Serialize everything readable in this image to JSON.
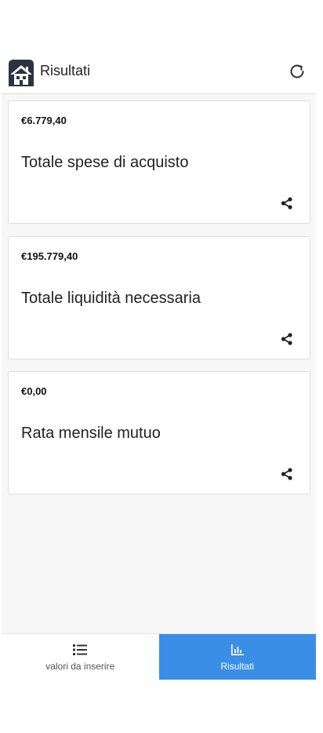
{
  "header": {
    "title": "Risultati",
    "logo_icon": "house-icon",
    "refresh_icon": "refresh-icon"
  },
  "cards": [
    {
      "amount": "€6.779,40",
      "label": "Totale spese di acquisto",
      "action_icon": "share-icon"
    },
    {
      "amount": "€195.779,40",
      "label": "Totale liquidità necessaria",
      "action_icon": "share-icon"
    },
    {
      "amount": "€0,00",
      "label": "Rata mensile mutuo",
      "action_icon": "share-icon"
    }
  ],
  "tabs": [
    {
      "label": "valori da inserire",
      "icon": "list-icon",
      "active": false
    },
    {
      "label": "Risultati",
      "icon": "bar-chart-icon",
      "active": true
    }
  ],
  "colors": {
    "accent": "#3a8ee6",
    "logo_dark": "#2b3340",
    "background": "#f7f7f7"
  }
}
